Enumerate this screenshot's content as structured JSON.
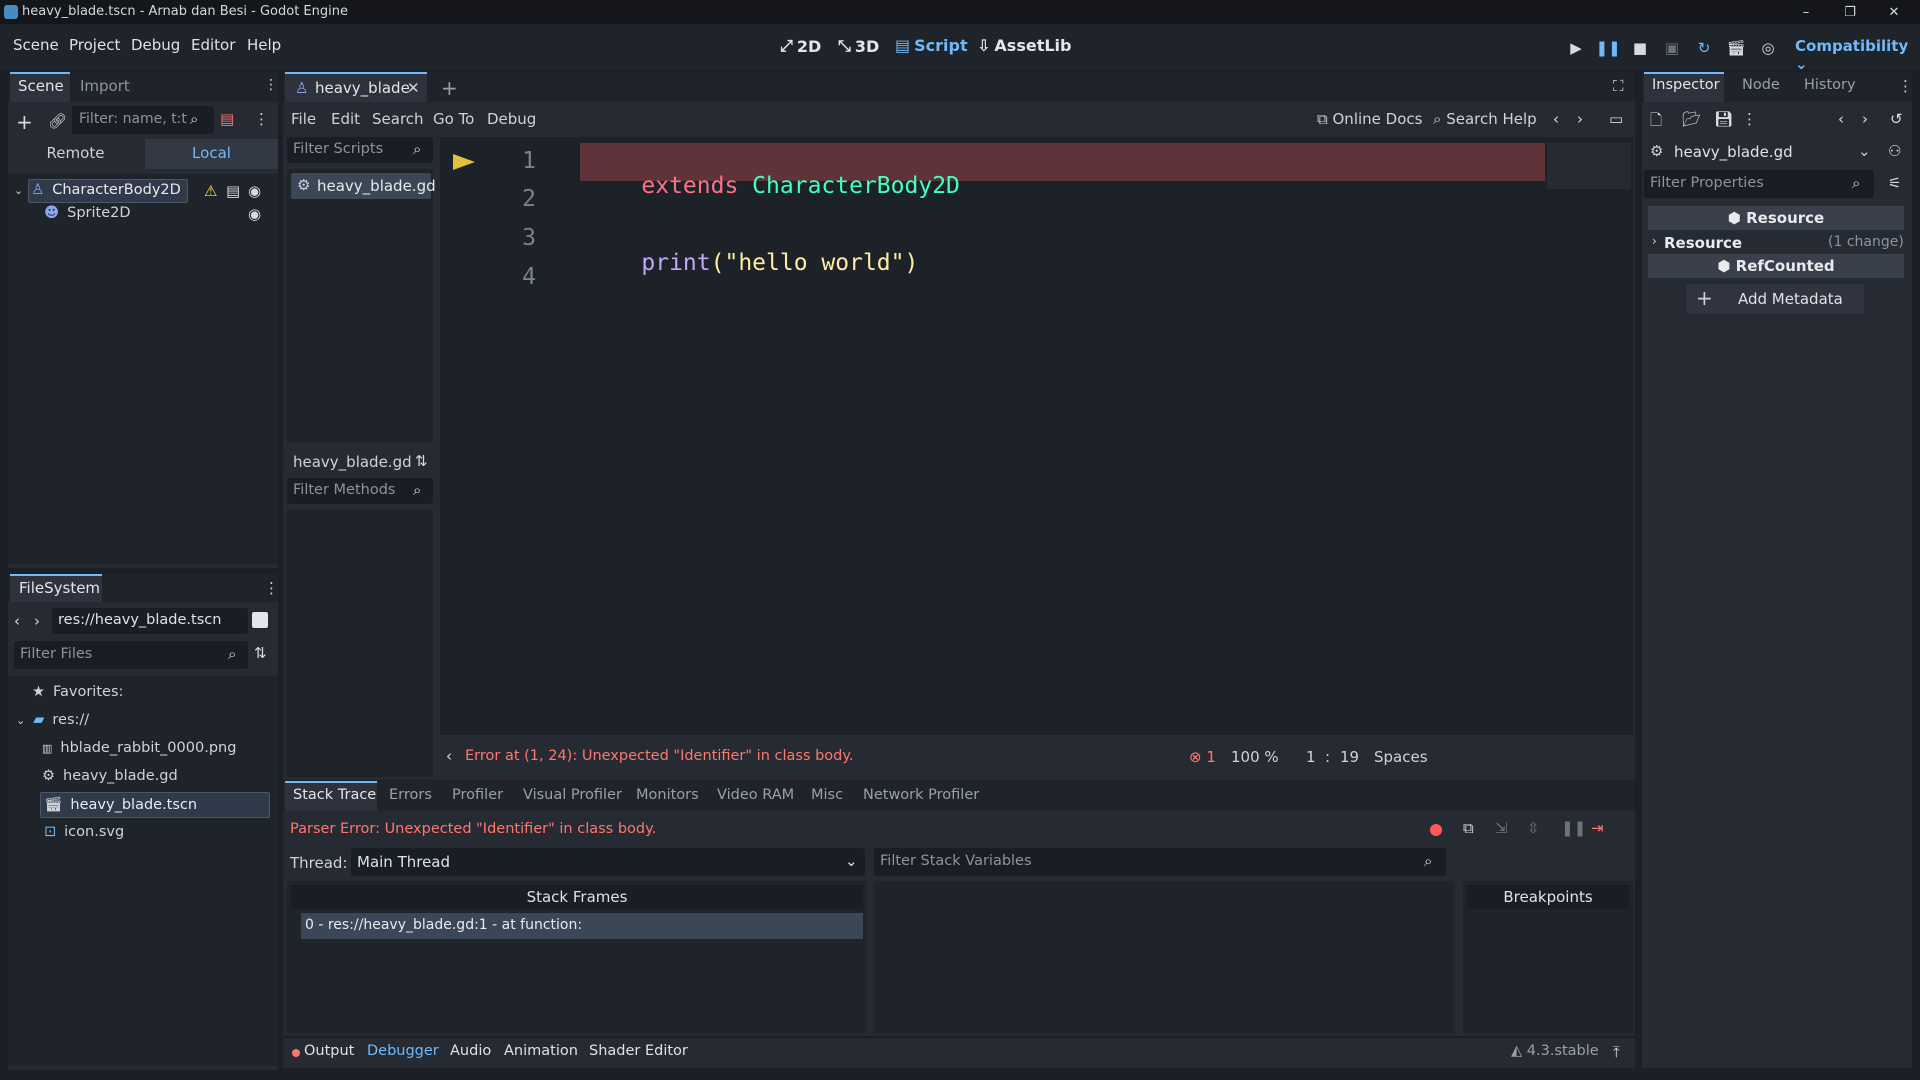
{
  "window": {
    "title": "heavy_blade.tscn - Arnab dan Besi - Godot Engine"
  },
  "menu": [
    "Scene",
    "Project",
    "Debug",
    "Editor",
    "Help"
  ],
  "workspaces": {
    "w2d": "2D",
    "w3d": "3D",
    "script": "Script",
    "assetlib": "AssetLib"
  },
  "renderer": "Compatibility",
  "scene_dock": {
    "tab_scene": "Scene",
    "tab_import": "Import",
    "filter_placeholder": "Filter: name, t:t",
    "remote": "Remote",
    "local": "Local",
    "nodes": [
      {
        "name": "CharacterBody2D",
        "icon": "characterbody2d-icon"
      },
      {
        "name": "Sprite2D",
        "icon": "sprite2d-icon"
      }
    ]
  },
  "filesystem": {
    "title": "FileSystem",
    "path": "res://heavy_blade.tscn",
    "filter_placeholder": "Filter Files",
    "favorites": "Favorites:",
    "root": "res://",
    "files": [
      {
        "name": "hblade_rabbit_0000.png"
      },
      {
        "name": "heavy_blade.gd"
      },
      {
        "name": "heavy_blade.tscn"
      },
      {
        "name": "icon.svg"
      }
    ]
  },
  "script_editor": {
    "tab": "heavy_blade",
    "menu": [
      "File",
      "Edit",
      "Search",
      "Go To",
      "Debug"
    ],
    "online_docs": "Online Docs",
    "search_help": "Search Help",
    "filter_scripts": "Filter Scripts",
    "script_item": "heavy_blade.gd",
    "methods_title": "heavy_blade.gd",
    "filter_methods": "Filter Methods",
    "lines": [
      {
        "n": "1",
        "a": "extends",
        "b": " CharacterBody2D"
      },
      {
        "n": "2",
        "a": "",
        "b": ""
      },
      {
        "n": "3",
        "a": "print",
        "b": "(\"hello world\")"
      },
      {
        "n": "4",
        "a": "",
        "b": ""
      }
    ],
    "error": "Error at (1, 24): Unexpected \"Identifier\" in class body.",
    "error_count": "1",
    "zoom": "100 %",
    "line": "1",
    "col": "19",
    "indent": "Spaces"
  },
  "debugger": {
    "tabs": [
      "Stack Trace",
      "Errors",
      "Profiler",
      "Visual Profiler",
      "Monitors",
      "Video RAM",
      "Misc",
      "Network Profiler"
    ],
    "parser_error": "Parser Error: Unexpected \"Identifier\" in class body.",
    "thread_label": "Thread:",
    "thread_value": "Main Thread",
    "filter_vars": "Filter Stack Variables",
    "stack_frames": "Stack Frames",
    "frame0": "0 - res://heavy_blade.gd:1 - at function:",
    "breakpoints": "Breakpoints"
  },
  "bottom_bar": {
    "tabs": [
      "Output",
      "Debugger",
      "Audio",
      "Animation",
      "Shader Editor"
    ],
    "version": "4.3.stable"
  },
  "inspector": {
    "tabs": [
      "Inspector",
      "Node",
      "History"
    ],
    "resource_name": "heavy_blade.gd",
    "filter_placeholder": "Filter Properties",
    "section_resource": "Resource",
    "resource_row": "Resource",
    "resource_changes": "(1 change)",
    "section_refcounted": "RefCounted",
    "add_metadata": "Add Metadata"
  },
  "colors": {
    "accent": "#70bafa",
    "error": "#ff786b",
    "keyword": "#ff7085",
    "type": "#42ffc2",
    "string": "#ffeda1",
    "func": "#bfa6ff"
  }
}
